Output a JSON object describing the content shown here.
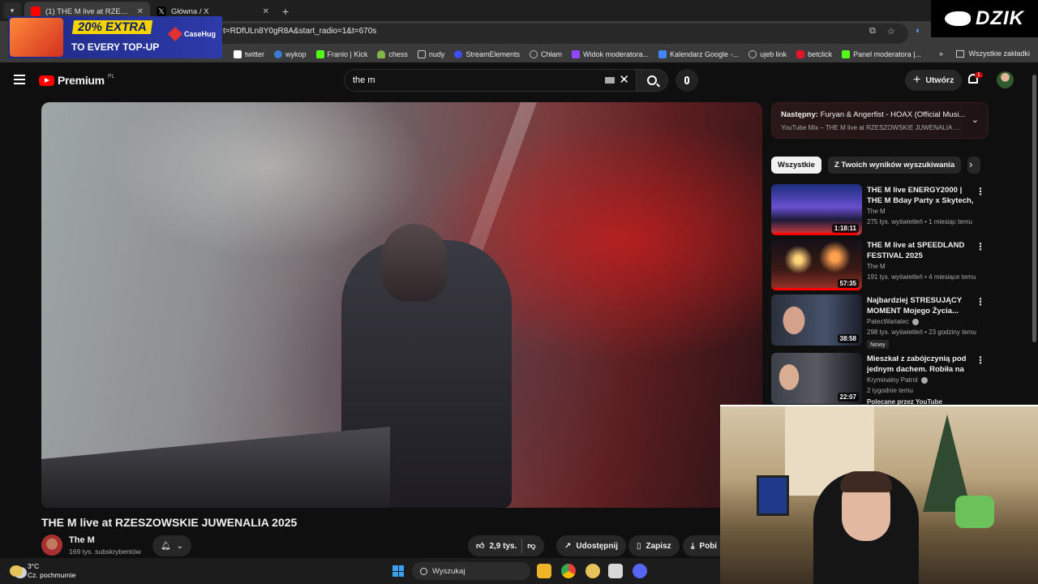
{
  "browser": {
    "tabs": [
      {
        "title": "(1) THE M live at RZESZOWSKIE",
        "active": true,
        "icon": "youtube-icon"
      },
      {
        "title": "Główna / X",
        "active": false,
        "icon": "x-icon"
      }
    ],
    "address": "t=RDfULn8Y0gR8A&start_radio=1&t=670s",
    "bookmarks": [
      {
        "label": "twitter",
        "icon": "x-icon",
        "color": "#ffffff"
      },
      {
        "label": "wykop",
        "icon": "wykop-icon",
        "color": "#3b7ad1"
      },
      {
        "label": "Franio | Kick",
        "icon": "kick-icon",
        "color": "#53fc18"
      },
      {
        "label": "chess",
        "icon": "pawn-icon",
        "color": "#81b64c"
      },
      {
        "label": "nudy",
        "icon": "folder-icon",
        "color": "#cccccc"
      },
      {
        "label": "StreamElements",
        "icon": "streamelements-icon",
        "color": "#3f4df5"
      },
      {
        "label": "Chłam",
        "icon": "globe-icon",
        "color": "#bbbbbb"
      },
      {
        "label": "Widok moderatora...",
        "icon": "twitch-icon",
        "color": "#9146ff"
      },
      {
        "label": "Kalendarz Google -...",
        "icon": "calendar-icon",
        "color": "#4285f4"
      },
      {
        "label": "ujeb link",
        "icon": "globe-icon",
        "color": "#bbbbbb"
      },
      {
        "label": "betclick",
        "icon": "betclick-icon",
        "color": "#e3152b"
      },
      {
        "label": "Panel moderatora |...",
        "icon": "kick-icon",
        "color": "#53fc18"
      }
    ],
    "all_bookmarks": "Wszystkie zakładki"
  },
  "ad": {
    "line1": "20% EXTRA",
    "line2": "TO EVERY TOP-UP",
    "brand": "CaseHug"
  },
  "overlay_logo": "DZIK",
  "youtube": {
    "logo": "Premium",
    "region": "PL",
    "search_query": "the m",
    "create_label": "Utwórz",
    "notifications": "1"
  },
  "video": {
    "title": "THE M live at RZESZOWSKIE JUWENALIA 2025",
    "channel": "The M",
    "subscribers": "169 tys. subskrybentów",
    "likes": "2,9 tys.",
    "share": "Udostępnij",
    "save": "Zapisz",
    "download": "Pobi"
  },
  "up_next": {
    "label": "Następny:",
    "title": "Furyan & Angerfist - HOAX (Official Musi...",
    "subtitle": "YouTube Mix – THE M live at RZESZOWSKIE JUWENALIA 20..."
  },
  "chips": [
    "Wszystkie",
    "Z Twoich wyników wyszukiwania"
  ],
  "recommendations": [
    {
      "title": "THE M live ENERGY2000 | THE M Bday Party x Skytech, DJ ...",
      "channel": "The M",
      "meta": "275 tys. wyświetleń • 1 miesiąc temu",
      "duration": "1:18:11",
      "progress": 0.95,
      "verified": false,
      "badge": "",
      "thumb": "concert-blue"
    },
    {
      "title": "THE M live at SPEEDLAND FESTIVAL 2025",
      "channel": "The M",
      "meta": "191 tys. wyświetleń • 4 miesiące temu",
      "duration": "57:35",
      "progress": 0.97,
      "verified": false,
      "badge": "",
      "thumb": "fireworks"
    },
    {
      "title": "Najbardziej STRESUJĄCY MOMENT Mojego Życia...",
      "channel": "PatecWariatec",
      "meta": "298 tys. wyświetleń • 23 godziny temu",
      "duration": "38:58",
      "progress": 0,
      "verified": true,
      "badge": "Nowy",
      "thumb": "portrait-dark"
    },
    {
      "title": "Mieszkał z zabójczynią pod jednym dachem. Robiła na ni...",
      "channel": "Kryminalny Patrol",
      "meta": "2 tygodnie temu",
      "extra": "Polecane przez YouTube",
      "duration": "22:07",
      "progress": 0,
      "verified": true,
      "badge": "",
      "thumb": "crime"
    }
  ],
  "taskbar": {
    "temperature": "3°C",
    "weather": "Cz. pochmurnie",
    "search_placeholder": "Wyszukaj"
  },
  "colors": {
    "accent": "#ff0000",
    "background": "#0f0f0f",
    "chip_active": "#f1f1f1"
  }
}
